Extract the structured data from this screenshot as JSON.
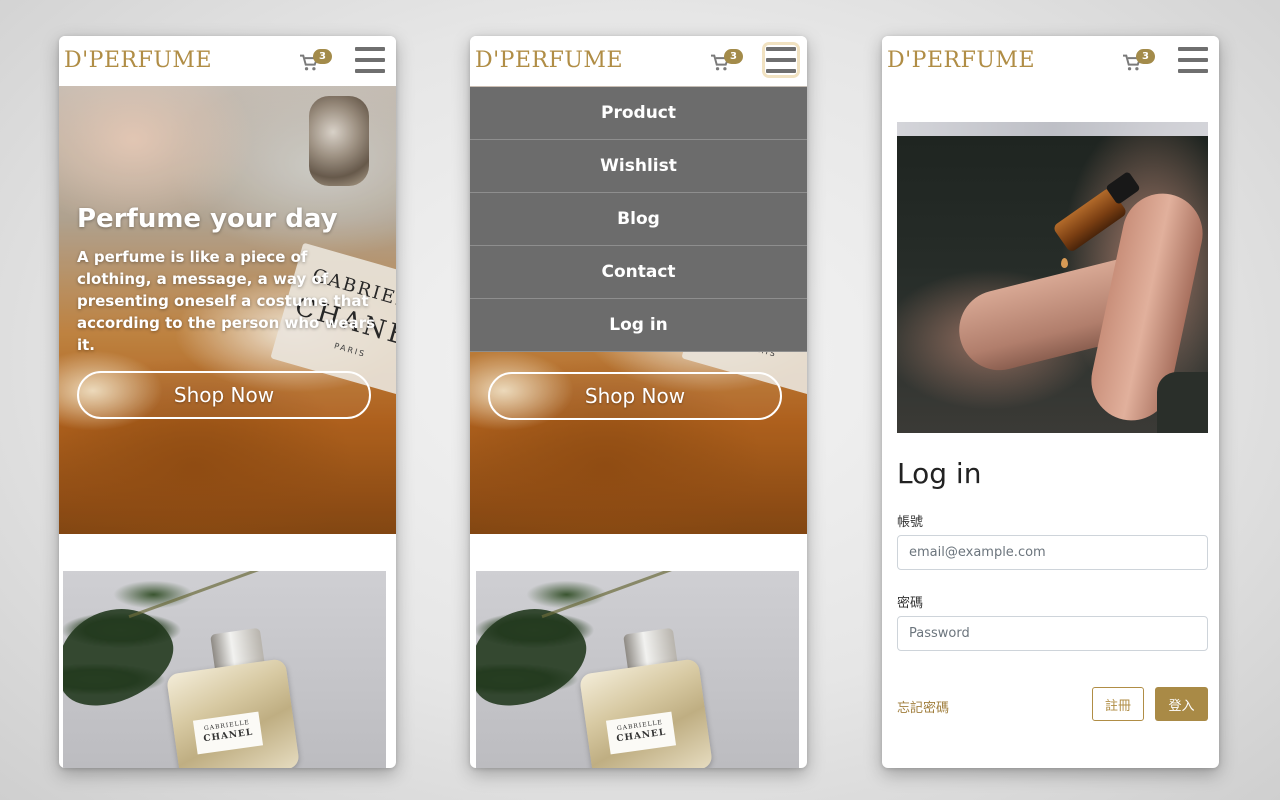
{
  "brand": {
    "logo": "D'PERFUME"
  },
  "navbar": {
    "cart_count": "3"
  },
  "hero": {
    "title": "Perfume your day",
    "text": "A perfume is like a piece of clothing, a message, a way of presenting oneself a costume that according to the person who wears it.",
    "button_label": "Shop Now"
  },
  "hero_image": {
    "label_line1": "GABRIEL",
    "label_line2": "CHANEL",
    "label_line3": "PARIS"
  },
  "product_image": {
    "label_line1": "GABRIELLE",
    "label_line2": "CHANEL"
  },
  "menu": {
    "items": [
      {
        "label": "Product"
      },
      {
        "label": "Wishlist"
      },
      {
        "label": "Blog"
      },
      {
        "label": "Contact"
      },
      {
        "label": "Log in"
      }
    ]
  },
  "login": {
    "title": "Log in",
    "account_label": "帳號",
    "account_placeholder": "email@example.com",
    "password_label": "密碼",
    "password_placeholder": "Password",
    "forgot_label": "忘記密碼",
    "register_label": "註冊",
    "login_label": "登入"
  },
  "colors": {
    "accent": "#b08d45",
    "menu_bg": "#6c6c6c",
    "badge": "#a38b4a"
  }
}
